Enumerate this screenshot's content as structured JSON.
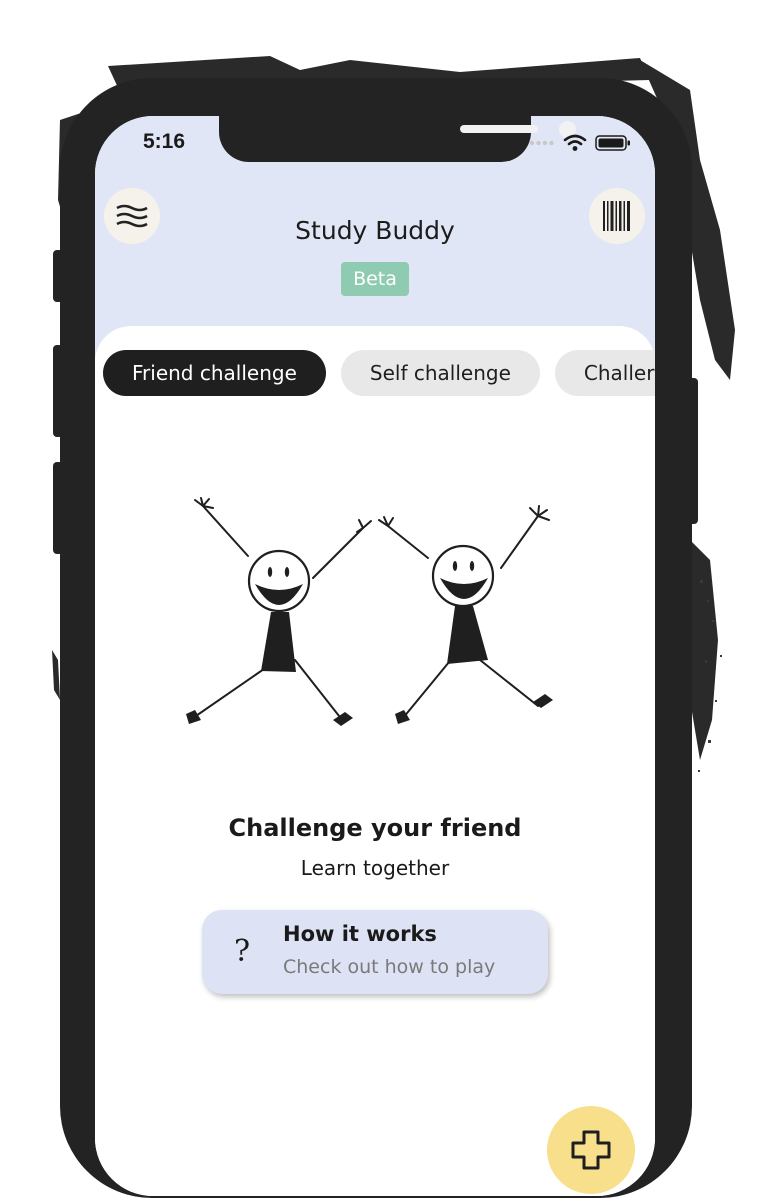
{
  "status_bar": {
    "time": "5:16"
  },
  "header": {
    "title": "Study Buddy",
    "badge": "Beta"
  },
  "tabs": [
    {
      "label": "Friend challenge",
      "active": true
    },
    {
      "label": "Self challenge",
      "active": false
    },
    {
      "label": "Challer",
      "active": false
    }
  ],
  "main": {
    "heading": "Challenge your friend",
    "subheading": "Learn together",
    "how_it_works": {
      "title": "How it works",
      "subtitle": "Check out how to play"
    }
  },
  "icons": {
    "menu": "wavy-lines-icon",
    "scan": "barcode-icon",
    "help": "question-mark-icon",
    "add": "plus-icon",
    "wifi": "wifi-icon",
    "battery": "battery-icon",
    "signal": "signal-dots-icon"
  },
  "colors": {
    "header_bg": "#e1e6f6",
    "badge": "#8fcbb1",
    "active_tab": "#1f1f1f",
    "inactive_tab": "#e8e8e8",
    "card_bg": "#dde2f4",
    "fab": "#f7df8c"
  }
}
